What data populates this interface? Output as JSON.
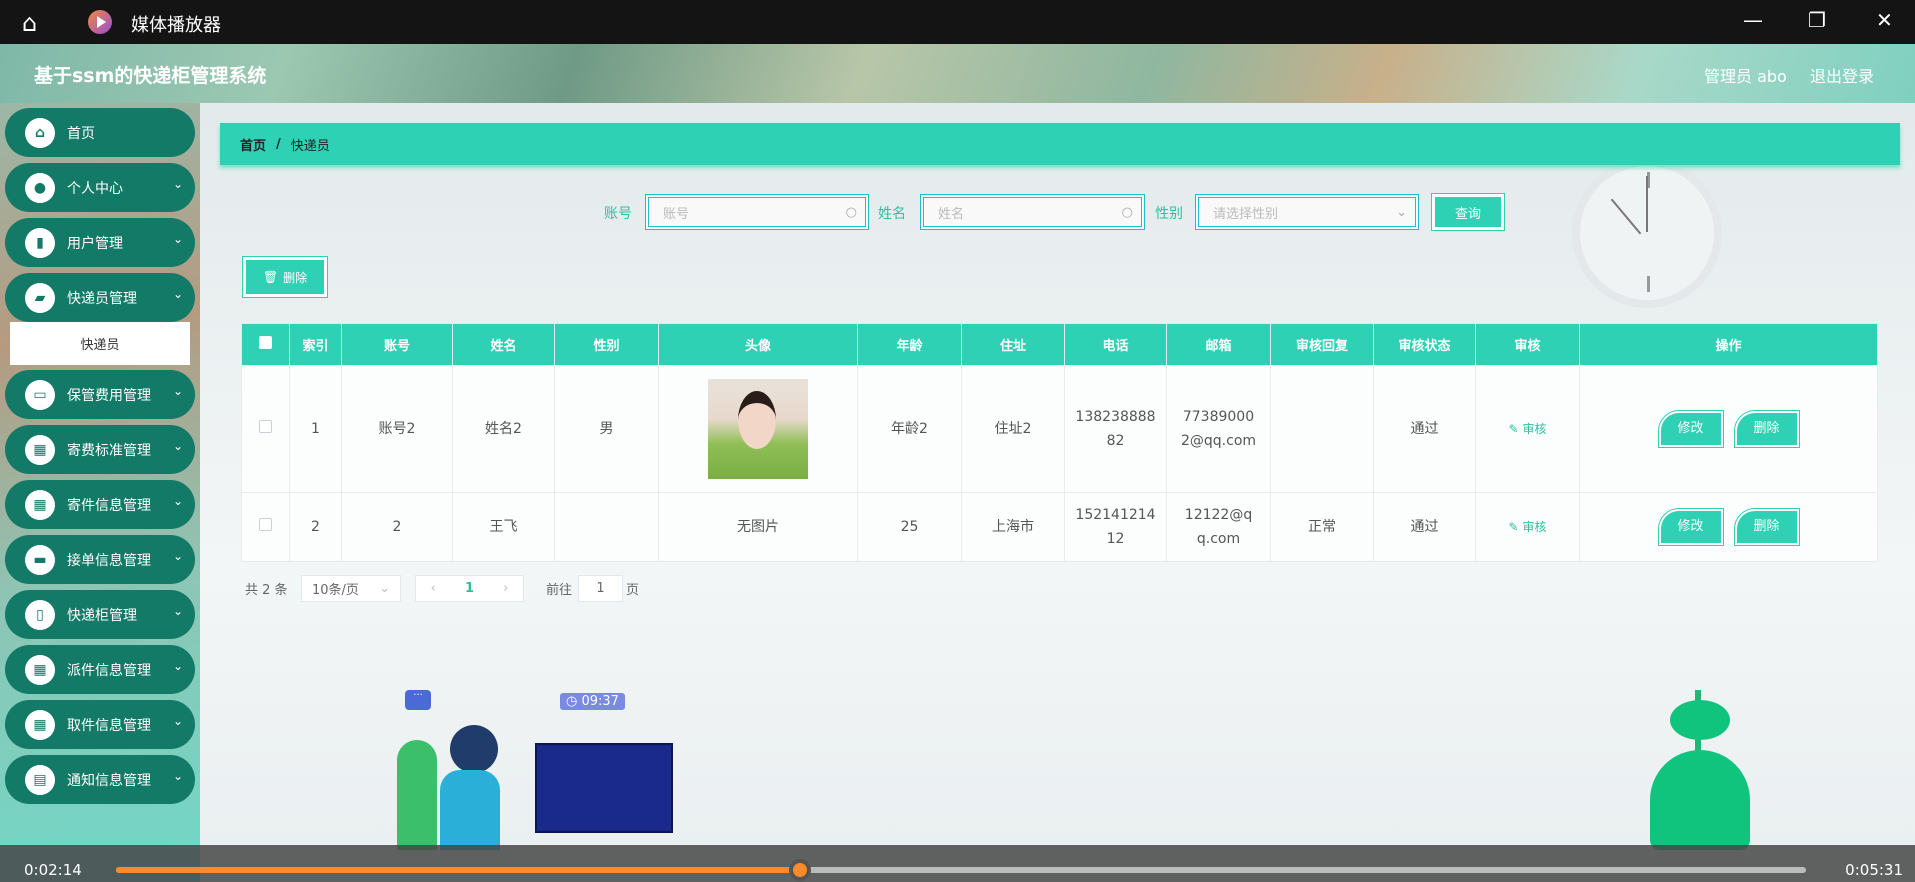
{
  "window": {
    "title": "媒体播放器",
    "icons": [
      "home-icon",
      "player-logo-icon",
      "minimize-icon",
      "restore-icon",
      "close-icon"
    ]
  },
  "header": {
    "system_title": "基于ssm的快递柜管理系统",
    "user": "管理员 abo",
    "logout": "退出登录"
  },
  "sidebar": {
    "items": [
      {
        "label": "首页",
        "icon": "home-icon",
        "glyph": "⌂"
      },
      {
        "label": "个人中心",
        "icon": "user-icon",
        "glyph": "●"
      },
      {
        "label": "用户管理",
        "icon": "bar-chart-icon",
        "glyph": "▮"
      },
      {
        "label": "快递员管理",
        "icon": "wallet-icon",
        "glyph": "▰"
      },
      {
        "label": "保管费用管理",
        "icon": "monitor-icon",
        "glyph": "▭"
      },
      {
        "label": "寄费标准管理",
        "icon": "grid-icon",
        "glyph": "▦"
      },
      {
        "label": "寄件信息管理",
        "icon": "grid-icon",
        "glyph": "▦"
      },
      {
        "label": "接单信息管理",
        "icon": "briefcase-icon",
        "glyph": "▬"
      },
      {
        "label": "快递柜管理",
        "icon": "book-icon",
        "glyph": "▯"
      },
      {
        "label": "派件信息管理",
        "icon": "grid-icon",
        "glyph": "▦"
      },
      {
        "label": "取件信息管理",
        "icon": "grid-icon",
        "glyph": "▦"
      },
      {
        "label": "通知信息管理",
        "icon": "clipboard-icon",
        "glyph": "▤"
      }
    ],
    "sub_item": "快递员"
  },
  "breadcrumb": {
    "home": "首页",
    "sep": "/",
    "current": "快递员"
  },
  "search": {
    "account_label": "账号",
    "account_placeholder": "账号",
    "name_label": "姓名",
    "name_placeholder": "姓名",
    "gender_label": "性别",
    "gender_placeholder": "请选择性别",
    "query_button": "查询"
  },
  "toolbar": {
    "delete_button": "删除"
  },
  "table": {
    "columns": [
      "索引",
      "账号",
      "姓名",
      "性别",
      "头像",
      "年龄",
      "住址",
      "电话",
      "邮箱",
      "审核回复",
      "审核状态",
      "审核",
      "操作"
    ],
    "rows": [
      {
        "index": "1",
        "account": "账号2",
        "name": "姓名2",
        "gender": "男",
        "avatar": "photo",
        "age": "年龄2",
        "address": "住址2",
        "phone": "13823888882",
        "email": "773890002@qq.com",
        "reply": "",
        "status": "通过",
        "audit": "审核",
        "edit": "修改",
        "delete": "删除"
      },
      {
        "index": "2",
        "account": "2",
        "name": "王飞",
        "gender": "",
        "avatar": "无图片",
        "age": "25",
        "address": "上海市",
        "phone": "15214121412",
        "email": "12122@qq.com",
        "reply": "正常",
        "status": "通过",
        "audit": "审核",
        "edit": "修改",
        "delete": "删除"
      }
    ]
  },
  "pagination": {
    "total": "共 2 条",
    "page_size": "10条/页",
    "current_page": "1",
    "goto_label": "前往",
    "goto_value": "1",
    "page_suffix": "页"
  },
  "illustration": {
    "time_badge": "09:37"
  },
  "player": {
    "elapsed": "0:02:14",
    "duration": "0:05:31",
    "progress_percent": 40.5,
    "accent": "#ff8a2a"
  },
  "colors": {
    "teal": "#2fd1b5",
    "nav": "#127a66"
  }
}
